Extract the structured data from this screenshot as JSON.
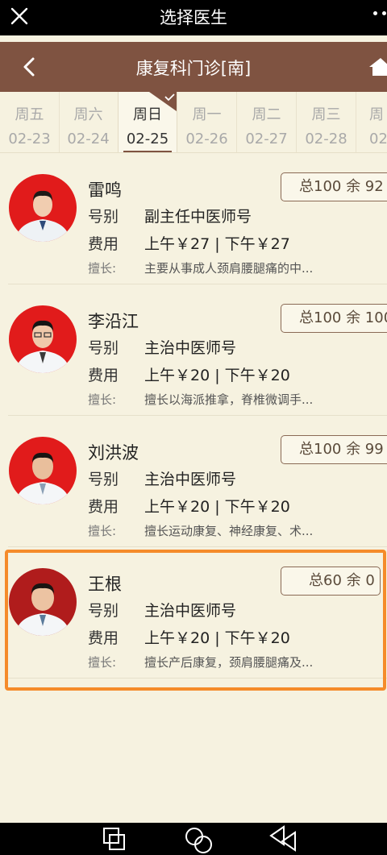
{
  "wechat_bar": {
    "title": "选择医生"
  },
  "nav": {
    "title": "康复科门诊[南]"
  },
  "dates": [
    {
      "weekday": "周五",
      "date": "02-23",
      "selected": false
    },
    {
      "weekday": "周六",
      "date": "02-24",
      "selected": false
    },
    {
      "weekday": "周日",
      "date": "02-25",
      "selected": true
    },
    {
      "weekday": "周一",
      "date": "02-26",
      "selected": false
    },
    {
      "weekday": "周二",
      "date": "02-27",
      "selected": false
    },
    {
      "weekday": "周三",
      "date": "02-28",
      "selected": false
    },
    {
      "weekday": "周",
      "date": "02-",
      "selected": false
    }
  ],
  "labels": {
    "type": "号别",
    "fee": "费用",
    "specialty": "擅长:"
  },
  "doctors": [
    {
      "name": "雷鸣",
      "quota": "总100 余 92",
      "type": "副主任中医师号",
      "fee": "上午￥27 | 下午￥27",
      "specialty": "主要从事成人颈肩腰腿痛的中...",
      "shirt": "#e8eef2",
      "bg": "#e11b1b"
    },
    {
      "name": "李沿江",
      "quota": "总100 余 100",
      "type": "主治中医师号",
      "fee": "上午￥20 | 下午￥20",
      "specialty": "擅长以海派推拿，脊椎微调手...",
      "shirt": "#f4f6f8",
      "bg": "#e11b1b"
    },
    {
      "name": "刘洪波",
      "quota": "总100 余 99",
      "type": "主治中医师号",
      "fee": "上午￥20 | 下午￥20",
      "specialty": "擅长运动康复、神经康复、术...",
      "shirt": "#f4f6f8",
      "bg": "#e11b1b"
    },
    {
      "name": "王根",
      "quota": "总60 余 0",
      "type": "主治中医师号",
      "fee": "上午￥20 | 下午￥20",
      "specialty": "擅长产后康复，颈肩腰腿痛及...",
      "shirt": "#f4f6f8",
      "bg": "#b01c1c"
    }
  ]
}
